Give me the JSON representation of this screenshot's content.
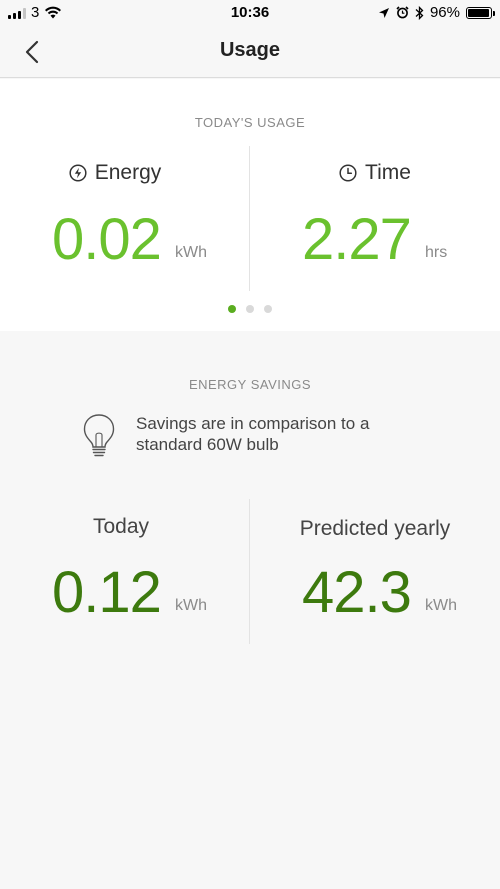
{
  "status_bar": {
    "carrier": "3",
    "time": "10:36",
    "battery_percent": "96%",
    "battery_level": 0.96,
    "icons": [
      "signal-icon",
      "wifi-icon",
      "location-arrow-icon",
      "alarm-icon",
      "bluetooth-icon",
      "battery-icon"
    ]
  },
  "nav": {
    "title": "Usage",
    "back_icon": "chevron-left-icon"
  },
  "todays_usage": {
    "heading": "TODAY'S USAGE",
    "energy": {
      "label": "Energy",
      "icon": "lightning-icon",
      "value": "0.02",
      "unit": "kWh"
    },
    "time": {
      "label": "Time",
      "icon": "clock-icon",
      "value": "2.27",
      "unit": "hrs"
    },
    "pager": {
      "count": 3,
      "active_index": 0
    }
  },
  "energy_savings": {
    "heading": "ENERGY SAVINGS",
    "note": "Savings are in comparison to a standard 60W bulb",
    "note_icon": "lightbulb-icon",
    "today": {
      "label": "Today",
      "value": "0.12",
      "unit": "kWh"
    },
    "yearly": {
      "label": "Predicted yearly",
      "value": "42.3",
      "unit": "kWh"
    }
  },
  "colors": {
    "accent_light_green": "#6ac12e",
    "accent_dark_green": "#3d7a0e",
    "pager_active": "#5aad1f"
  }
}
